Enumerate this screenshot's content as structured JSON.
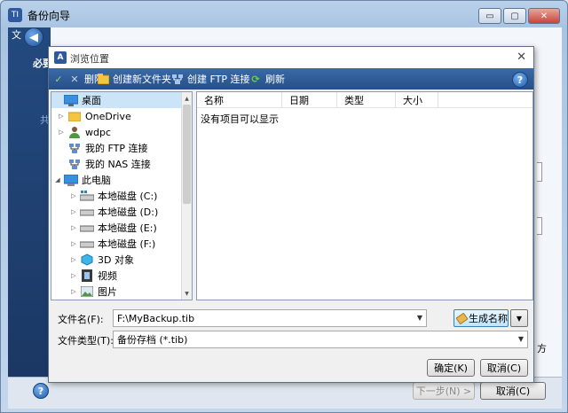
{
  "outer_window": {
    "title": "备份向导",
    "minimize": "▭",
    "maximize": "▢",
    "close": "✕",
    "left_partial": "文",
    "section_partial": "必要",
    "item_partial": "共",
    "right_partial": "方",
    "next_button": "下一步(N) >",
    "cancel_button": "取消(C)"
  },
  "dialog": {
    "title": "浏览位置",
    "close": "✕",
    "toolbar": {
      "delete": "删除",
      "new_folder": "创建新文件夹",
      "ftp": "创建 FTP 连接",
      "refresh": "刷新"
    },
    "tree": [
      {
        "label": "桌面",
        "icon": "desktop-icon",
        "expand": ""
      },
      {
        "label": "OneDrive",
        "icon": "folder-icon",
        "expand": "▷"
      },
      {
        "label": "wdpc",
        "icon": "user-icon",
        "expand": "▷"
      },
      {
        "label": "我的 FTP 连接",
        "icon": "network-icon",
        "expand": ""
      },
      {
        "label": "我的 NAS 连接",
        "icon": "network-icon",
        "expand": ""
      },
      {
        "label": "此电脑",
        "icon": "computer-icon",
        "expand": "◢"
      },
      {
        "label": "本地磁盘 (C:)",
        "icon": "drive-icon",
        "expand": "▷"
      },
      {
        "label": "本地磁盘 (D:)",
        "icon": "drive-icon",
        "expand": "▷"
      },
      {
        "label": "本地磁盘 (E:)",
        "icon": "drive-icon",
        "expand": "▷"
      },
      {
        "label": "本地磁盘 (F:)",
        "icon": "drive-icon",
        "expand": "▷"
      },
      {
        "label": "3D 对象",
        "icon": "cube-icon",
        "expand": "▷"
      },
      {
        "label": "视频",
        "icon": "video-icon",
        "expand": "▷"
      },
      {
        "label": "图片",
        "icon": "picture-icon",
        "expand": "▷"
      }
    ],
    "columns": [
      "名称",
      "日期",
      "类型",
      "大小"
    ],
    "empty_message": "没有项目可以显示",
    "file_name_label": "文件名(F):",
    "file_name_value": "F:\\MyBackup.tib",
    "file_type_label": "文件类型(T):",
    "file_type_value": "备份存档 (*.tib)",
    "generate_name_button": "生成名称",
    "ok_button": "确定(K)",
    "cancel_button": "取消(C)"
  },
  "colors": {
    "toolbar": "#2f5d97",
    "selection": "#cce4f7",
    "outer_dark": "#1d3c6b"
  }
}
